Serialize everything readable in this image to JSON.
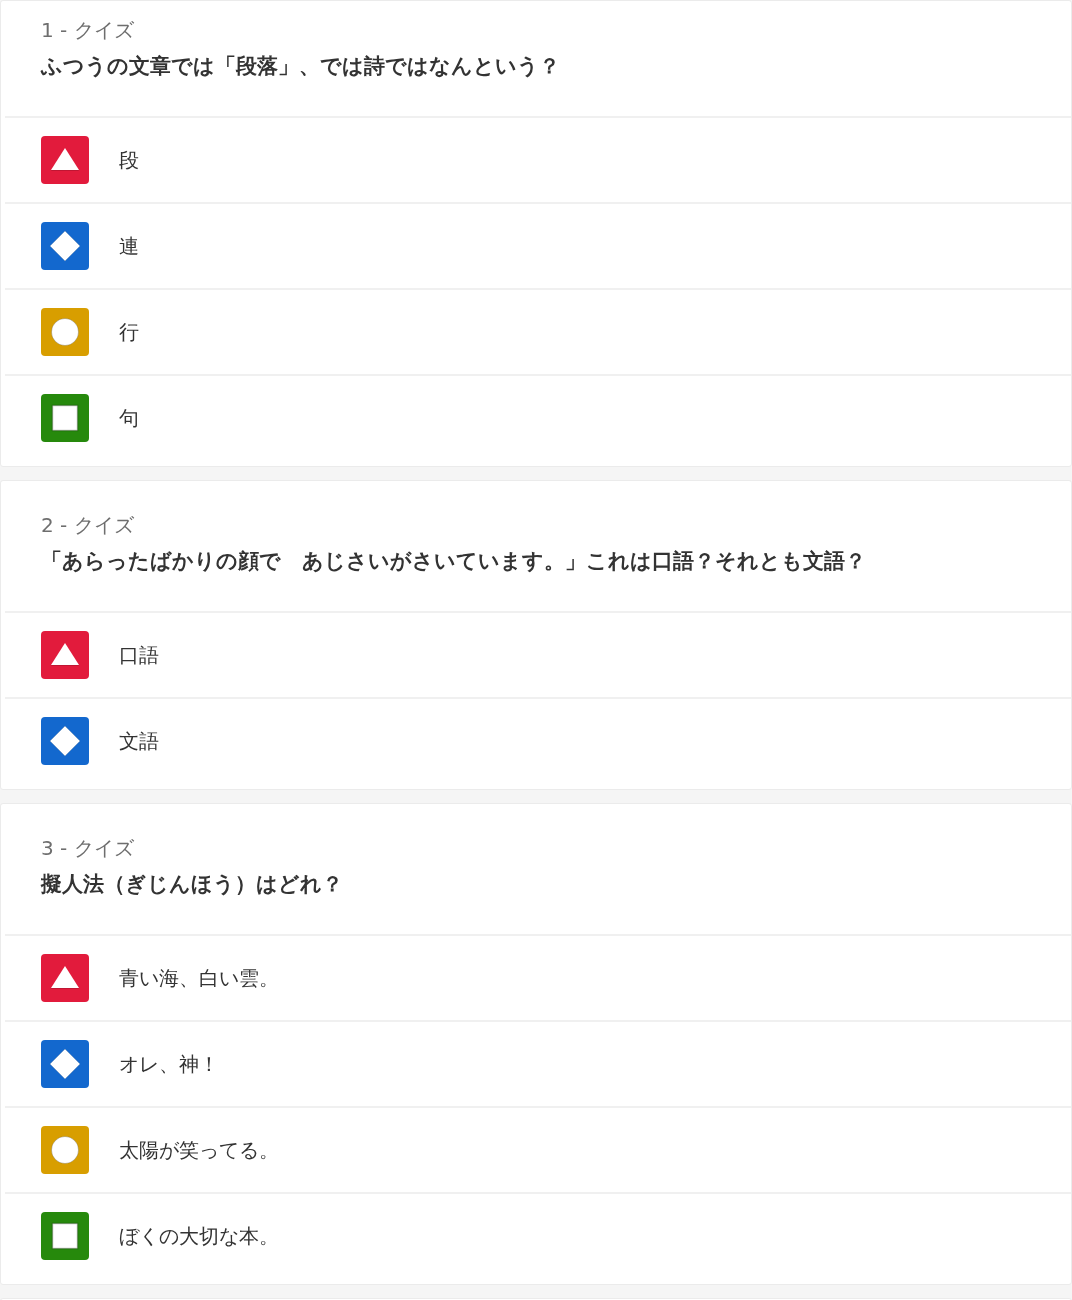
{
  "quizzes": [
    {
      "label": "1 - クイズ",
      "question": "ふつうの文章では「段落」、では詩ではなんという？",
      "answers": [
        {
          "kind": "triangle",
          "color": "#e21b3c",
          "text": "段"
        },
        {
          "kind": "diamond",
          "color": "#1368ce",
          "text": "連"
        },
        {
          "kind": "circle",
          "color": "#d89e00",
          "text": "行"
        },
        {
          "kind": "square",
          "color": "#26890c",
          "text": "句"
        }
      ]
    },
    {
      "label": "2 - クイズ",
      "question": "「あらったばかりの顔で　あじさいがさいています。」これは口語？それとも文語？",
      "answers": [
        {
          "kind": "triangle",
          "color": "#e21b3c",
          "text": "口語"
        },
        {
          "kind": "diamond",
          "color": "#1368ce",
          "text": "文語"
        }
      ]
    },
    {
      "label": "3 - クイズ",
      "question": "擬人法（ぎじんほう）はどれ？",
      "answers": [
        {
          "kind": "triangle",
          "color": "#e21b3c",
          "text": "青い海、白い雲。"
        },
        {
          "kind": "diamond",
          "color": "#1368ce",
          "text": "オレ、神！"
        },
        {
          "kind": "circle",
          "color": "#d89e00",
          "text": "太陽が笑ってる。"
        },
        {
          "kind": "square",
          "color": "#26890c",
          "text": "ぼくの大切な本。"
        }
      ]
    }
  ]
}
